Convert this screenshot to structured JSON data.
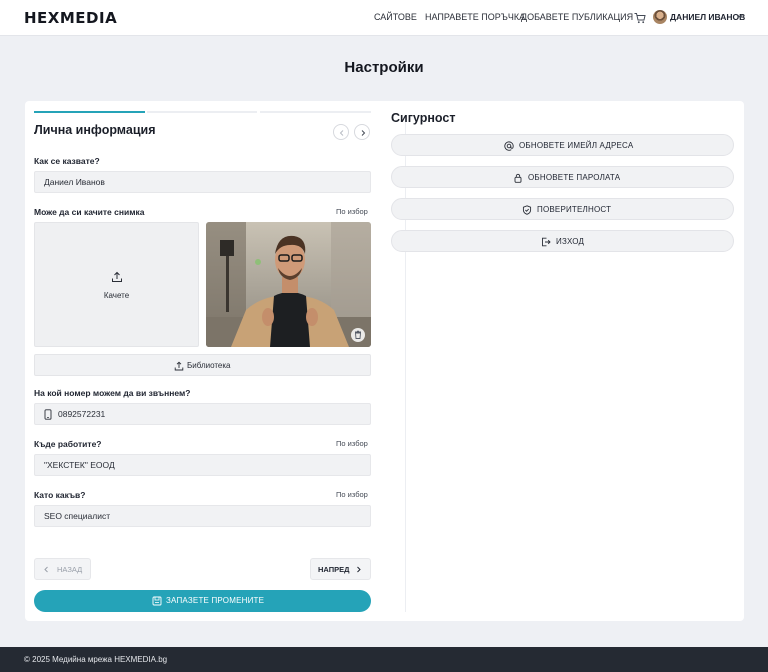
{
  "header": {
    "logo": "HEXMEDIA",
    "nav": [
      "САЙТОВЕ",
      "НАПРАВЕТЕ ПОРЪЧКА",
      "ДОБАВЕТЕ ПУБЛИКАЦИЯ"
    ],
    "user_name": "ДАНИЕЛ ИВАНОВ"
  },
  "page_title": "Настройки",
  "personal": {
    "title": "Лична информация",
    "name_label": "Как се казвате?",
    "name_value": "Даниел Иванов",
    "photo_label": "Може да си качите снимка",
    "photo_optional": "По избор",
    "upload_label": "Качете",
    "library_label": "Библиотека",
    "phone_label": "На кой номер можем да ви звъннем?",
    "phone_value": "0892572231",
    "work_label": "Къде работите?",
    "work_optional": "По избор",
    "work_value": "\"ХЕКСТЕК\" ЕООД",
    "role_label": "Като какъв?",
    "role_optional": "По избор",
    "role_value": "SEO специалист",
    "back_label": "НАЗАД",
    "next_label": "НАПРЕД",
    "save_label": "ЗАПАЗЕТЕ ПРОМЕНИТЕ"
  },
  "security": {
    "title": "Сигурност",
    "buttons": [
      "ОБНОВЕТЕ ИМЕЙЛ АДРЕСА",
      "ОБНОВЕТЕ ПАРОЛАТА",
      "ПОВЕРИТЕЛНОСТ",
      "ИЗХОД"
    ]
  },
  "footer": {
    "copyright": "© 2025 Медийна мрежа HEXMEDIA.bg"
  },
  "colors": {
    "accent": "#25a3b8",
    "footer_bg": "#252a33",
    "page_bg": "#eef0f4"
  },
  "icons": [
    "cart-icon",
    "chevron-down-icon",
    "chevron-left-icon",
    "chevron-right-icon",
    "upload-icon",
    "trash-icon",
    "phone-icon",
    "save-icon",
    "at-icon",
    "lock-icon",
    "shield-icon",
    "logout-icon"
  ]
}
